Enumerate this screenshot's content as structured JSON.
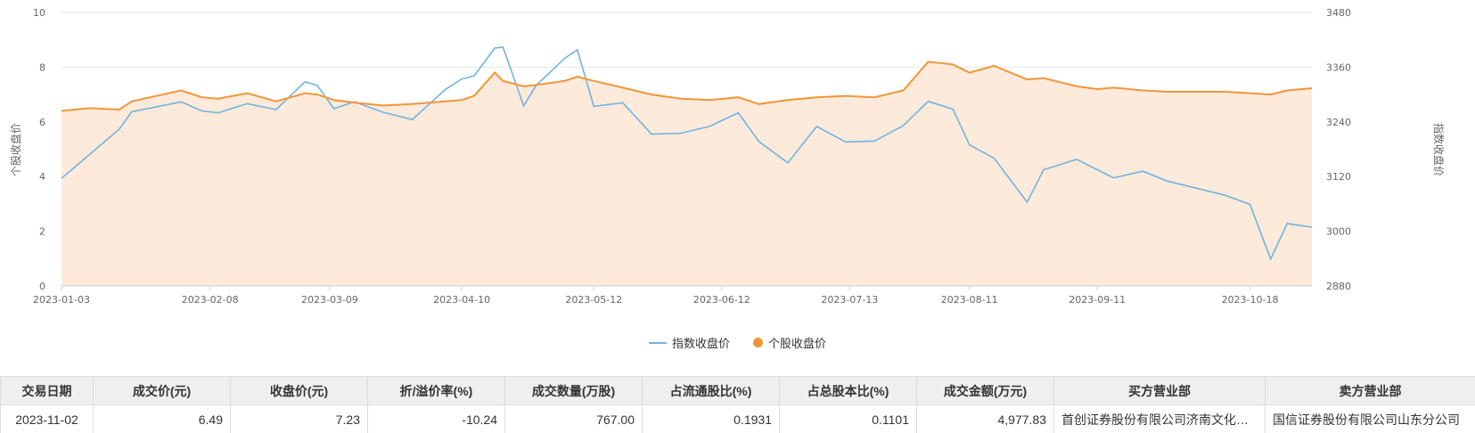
{
  "chart_data": {
    "type": "line",
    "title": "",
    "y_left": {
      "label": "个股收盘价",
      "min": 0,
      "max": 10,
      "ticks": [
        "0",
        "2",
        "4",
        "6",
        "8",
        "10"
      ]
    },
    "y_right": {
      "label": "指数收盘价",
      "min": 2880,
      "max": 3480,
      "ticks": [
        "2880",
        "3000",
        "3120",
        "3240",
        "3360",
        "3480"
      ]
    },
    "x_ticks": [
      "2023-01-03",
      "2023-02-08",
      "2023-03-09",
      "2023-04-10",
      "2023-05-12",
      "2023-06-12",
      "2023-07-13",
      "2023-08-11",
      "2023-09-11",
      "2023-10-18"
    ],
    "x_range": [
      "2023-01-03",
      "2023-11-02"
    ],
    "grid": true,
    "legend_position": "bottom",
    "series": [
      {
        "name": "指数收盘价",
        "axis": "right",
        "color": "#6fb4df",
        "points": [
          [
            "2023-01-03",
            3116
          ],
          [
            "2023-01-10",
            3170
          ],
          [
            "2023-01-17",
            3224
          ],
          [
            "2023-01-20",
            3262
          ],
          [
            "2023-02-01",
            3284
          ],
          [
            "2023-02-06",
            3264
          ],
          [
            "2023-02-10",
            3260
          ],
          [
            "2023-02-17",
            3280
          ],
          [
            "2023-02-24",
            3267
          ],
          [
            "2023-03-03",
            3328
          ],
          [
            "2023-03-06",
            3320
          ],
          [
            "2023-03-10",
            3269
          ],
          [
            "2023-03-15",
            3284
          ],
          [
            "2023-03-22",
            3261
          ],
          [
            "2023-03-29",
            3245
          ],
          [
            "2023-04-06",
            3311
          ],
          [
            "2023-04-10",
            3334
          ],
          [
            "2023-04-13",
            3341
          ],
          [
            "2023-04-18",
            3402
          ],
          [
            "2023-04-20",
            3404
          ],
          [
            "2023-04-25",
            3275
          ],
          [
            "2023-04-28",
            3320
          ],
          [
            "2023-05-05",
            3380
          ],
          [
            "2023-05-08",
            3398
          ],
          [
            "2023-05-12",
            3274
          ],
          [
            "2023-05-19",
            3282
          ],
          [
            "2023-05-26",
            3213
          ],
          [
            "2023-06-02",
            3215
          ],
          [
            "2023-06-09",
            3230
          ],
          [
            "2023-06-16",
            3260
          ],
          [
            "2023-06-21",
            3197
          ],
          [
            "2023-06-28",
            3150
          ],
          [
            "2023-07-05",
            3230
          ],
          [
            "2023-07-12",
            3196
          ],
          [
            "2023-07-19",
            3198
          ],
          [
            "2023-07-26",
            3232
          ],
          [
            "2023-08-01",
            3285
          ],
          [
            "2023-08-07",
            3268
          ],
          [
            "2023-08-11",
            3190
          ],
          [
            "2023-08-17",
            3160
          ],
          [
            "2023-08-25",
            3064
          ],
          [
            "2023-08-29",
            3135
          ],
          [
            "2023-09-06",
            3158
          ],
          [
            "2023-09-11",
            3135
          ],
          [
            "2023-09-15",
            3117
          ],
          [
            "2023-09-22",
            3132
          ],
          [
            "2023-09-28",
            3110
          ],
          [
            "2023-10-12",
            3079
          ],
          [
            "2023-10-18",
            3059
          ],
          [
            "2023-10-23",
            2939
          ],
          [
            "2023-10-27",
            3017
          ],
          [
            "2023-11-02",
            3009
          ]
        ]
      },
      {
        "name": "个股收盘价",
        "axis": "left",
        "color": "#f39536",
        "points": [
          [
            "2023-01-03",
            6.4
          ],
          [
            "2023-01-10",
            6.5
          ],
          [
            "2023-01-17",
            6.45
          ],
          [
            "2023-01-20",
            6.75
          ],
          [
            "2023-02-01",
            7.15
          ],
          [
            "2023-02-06",
            6.9
          ],
          [
            "2023-02-10",
            6.85
          ],
          [
            "2023-02-17",
            7.05
          ],
          [
            "2023-02-24",
            6.75
          ],
          [
            "2023-03-03",
            7.05
          ],
          [
            "2023-03-06",
            7.0
          ],
          [
            "2023-03-10",
            6.8
          ],
          [
            "2023-03-15",
            6.7
          ],
          [
            "2023-03-22",
            6.6
          ],
          [
            "2023-03-29",
            6.65
          ],
          [
            "2023-04-06",
            6.75
          ],
          [
            "2023-04-10",
            6.8
          ],
          [
            "2023-04-13",
            6.95
          ],
          [
            "2023-04-18",
            7.8
          ],
          [
            "2023-04-20",
            7.5
          ],
          [
            "2023-04-25",
            7.3
          ],
          [
            "2023-04-28",
            7.35
          ],
          [
            "2023-05-05",
            7.5
          ],
          [
            "2023-05-08",
            7.65
          ],
          [
            "2023-05-12",
            7.5
          ],
          [
            "2023-05-19",
            7.25
          ],
          [
            "2023-05-26",
            7.0
          ],
          [
            "2023-06-02",
            6.85
          ],
          [
            "2023-06-09",
            6.8
          ],
          [
            "2023-06-16",
            6.9
          ],
          [
            "2023-06-21",
            6.65
          ],
          [
            "2023-06-28",
            6.8
          ],
          [
            "2023-07-05",
            6.9
          ],
          [
            "2023-07-12",
            6.95
          ],
          [
            "2023-07-19",
            6.9
          ],
          [
            "2023-07-26",
            7.15
          ],
          [
            "2023-08-01",
            8.2
          ],
          [
            "2023-08-07",
            8.1
          ],
          [
            "2023-08-11",
            7.8
          ],
          [
            "2023-08-17",
            8.05
          ],
          [
            "2023-08-25",
            7.55
          ],
          [
            "2023-08-29",
            7.6
          ],
          [
            "2023-09-06",
            7.3
          ],
          [
            "2023-09-11",
            7.2
          ],
          [
            "2023-09-15",
            7.25
          ],
          [
            "2023-09-22",
            7.15
          ],
          [
            "2023-09-28",
            7.1
          ],
          [
            "2023-10-12",
            7.1
          ],
          [
            "2023-10-18",
            7.05
          ],
          [
            "2023-10-23",
            7.0
          ],
          [
            "2023-10-27",
            7.15
          ],
          [
            "2023-11-02",
            7.23
          ]
        ]
      }
    ]
  },
  "colors": {
    "index_line": "#6fb4df",
    "stock_line": "#f39536",
    "stock_fill": "#fdeadb"
  },
  "legend": {
    "index_label": "指数收盘价",
    "stock_label": "个股收盘价"
  },
  "table": {
    "headers": [
      "交易日期",
      "成交价(元)",
      "收盘价(元)",
      "折/溢价率(%)",
      "成交数量(万股)",
      "占流通股比(%)",
      "占总股本比(%)",
      "成交金额(万元)",
      "买方营业部",
      "卖方营业部"
    ],
    "rows": [
      [
        "2023-11-02",
        "6.49",
        "7.23",
        "-10.24",
        "767.00",
        "0.1931",
        "0.1101",
        "4,977.83",
        "首创证券股份有限公司济南文化东路证券营业部",
        "国信证券股份有限公司山东分公司"
      ]
    ]
  }
}
